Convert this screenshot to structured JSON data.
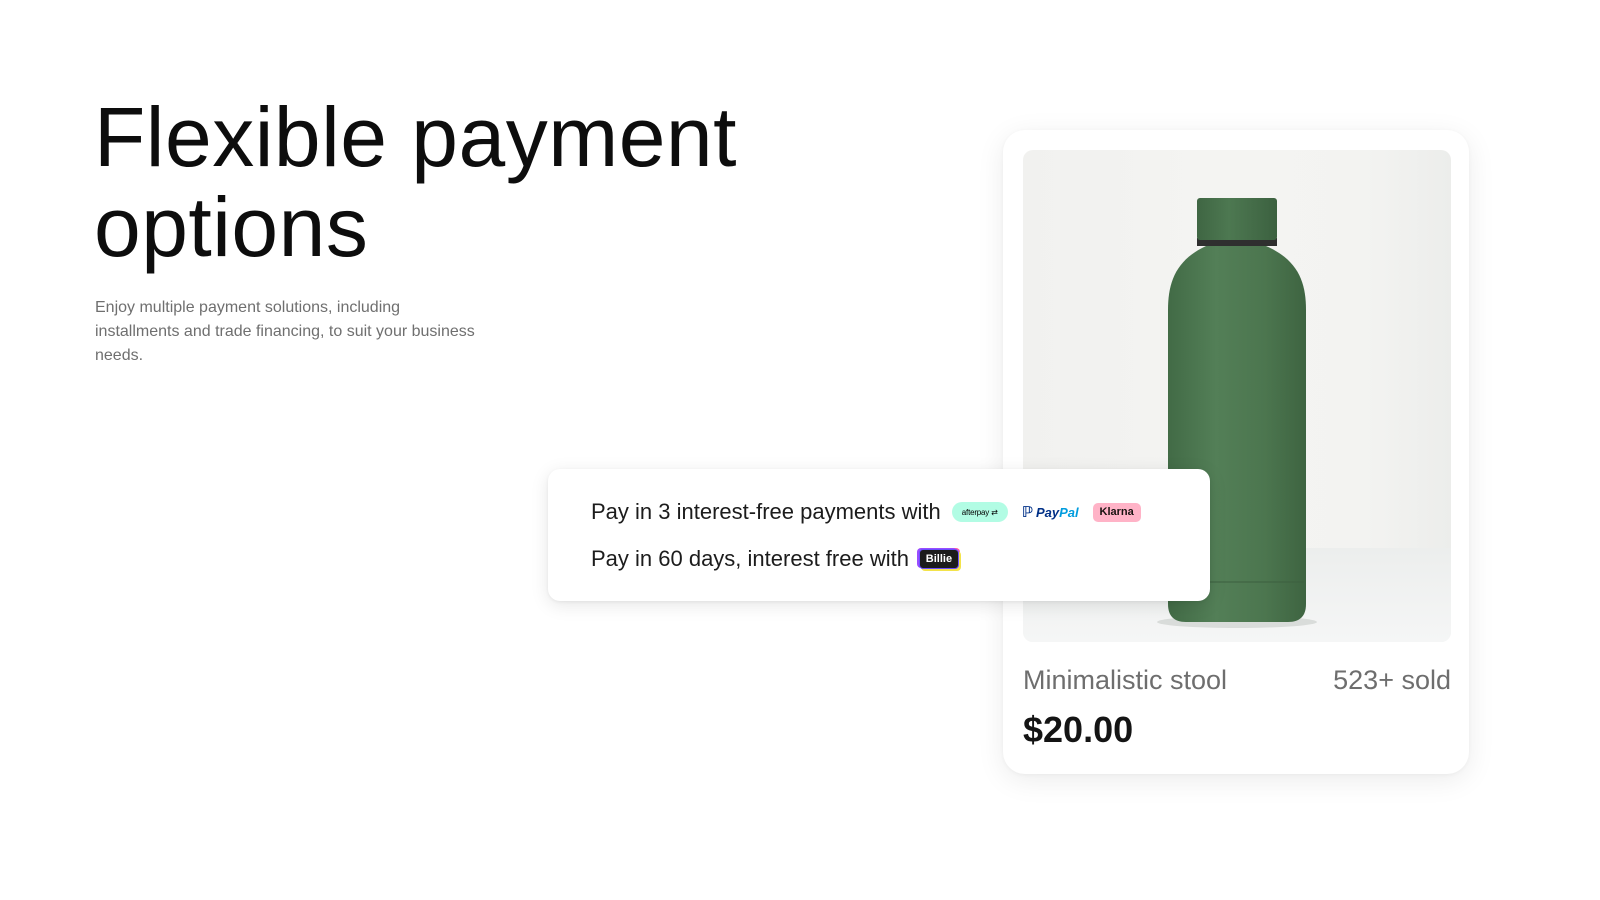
{
  "hero": {
    "title_line_1": "Flexible payment",
    "title_line_2": "options",
    "subtitle": "Enjoy multiple payment solutions, including installments and trade financing, to suit your business needs."
  },
  "product": {
    "image_subject": "green-water-bottle-image",
    "name": "Minimalistic stool",
    "sold": "523+ sold",
    "price": "$20.00"
  },
  "payment": {
    "row_1_text": "Pay in 3 interest-free payments with",
    "row_2_text": "Pay in 60 days, interest free with",
    "logos": {
      "afterpay": "afterpay",
      "paypal_pay": "Pay",
      "paypal_pal": "Pal",
      "klarna": "Klarna",
      "billie": "Billie"
    }
  },
  "colors": {
    "bottle_green": "#4f7a52",
    "afterpay_mint": "#b2fce4",
    "paypal_navy": "#003087",
    "paypal_blue": "#009cde",
    "klarna_pink": "#ffb3c7",
    "billie_dark": "#1b1b1b"
  }
}
